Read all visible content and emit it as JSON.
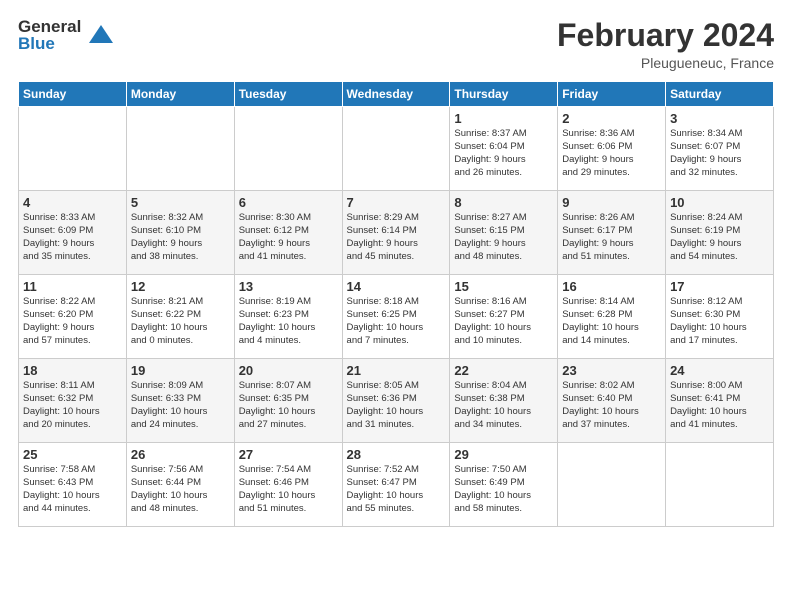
{
  "logo": {
    "general": "General",
    "blue": "Blue"
  },
  "title": "February 2024",
  "location": "Pleugueneuc, France",
  "days_of_week": [
    "Sunday",
    "Monday",
    "Tuesday",
    "Wednesday",
    "Thursday",
    "Friday",
    "Saturday"
  ],
  "weeks": [
    [
      {
        "day": "",
        "info": ""
      },
      {
        "day": "",
        "info": ""
      },
      {
        "day": "",
        "info": ""
      },
      {
        "day": "",
        "info": ""
      },
      {
        "day": "1",
        "info": "Sunrise: 8:37 AM\nSunset: 6:04 PM\nDaylight: 9 hours\nand 26 minutes."
      },
      {
        "day": "2",
        "info": "Sunrise: 8:36 AM\nSunset: 6:06 PM\nDaylight: 9 hours\nand 29 minutes."
      },
      {
        "day": "3",
        "info": "Sunrise: 8:34 AM\nSunset: 6:07 PM\nDaylight: 9 hours\nand 32 minutes."
      }
    ],
    [
      {
        "day": "4",
        "info": "Sunrise: 8:33 AM\nSunset: 6:09 PM\nDaylight: 9 hours\nand 35 minutes."
      },
      {
        "day": "5",
        "info": "Sunrise: 8:32 AM\nSunset: 6:10 PM\nDaylight: 9 hours\nand 38 minutes."
      },
      {
        "day": "6",
        "info": "Sunrise: 8:30 AM\nSunset: 6:12 PM\nDaylight: 9 hours\nand 41 minutes."
      },
      {
        "day": "7",
        "info": "Sunrise: 8:29 AM\nSunset: 6:14 PM\nDaylight: 9 hours\nand 45 minutes."
      },
      {
        "day": "8",
        "info": "Sunrise: 8:27 AM\nSunset: 6:15 PM\nDaylight: 9 hours\nand 48 minutes."
      },
      {
        "day": "9",
        "info": "Sunrise: 8:26 AM\nSunset: 6:17 PM\nDaylight: 9 hours\nand 51 minutes."
      },
      {
        "day": "10",
        "info": "Sunrise: 8:24 AM\nSunset: 6:19 PM\nDaylight: 9 hours\nand 54 minutes."
      }
    ],
    [
      {
        "day": "11",
        "info": "Sunrise: 8:22 AM\nSunset: 6:20 PM\nDaylight: 9 hours\nand 57 minutes."
      },
      {
        "day": "12",
        "info": "Sunrise: 8:21 AM\nSunset: 6:22 PM\nDaylight: 10 hours\nand 0 minutes."
      },
      {
        "day": "13",
        "info": "Sunrise: 8:19 AM\nSunset: 6:23 PM\nDaylight: 10 hours\nand 4 minutes."
      },
      {
        "day": "14",
        "info": "Sunrise: 8:18 AM\nSunset: 6:25 PM\nDaylight: 10 hours\nand 7 minutes."
      },
      {
        "day": "15",
        "info": "Sunrise: 8:16 AM\nSunset: 6:27 PM\nDaylight: 10 hours\nand 10 minutes."
      },
      {
        "day": "16",
        "info": "Sunrise: 8:14 AM\nSunset: 6:28 PM\nDaylight: 10 hours\nand 14 minutes."
      },
      {
        "day": "17",
        "info": "Sunrise: 8:12 AM\nSunset: 6:30 PM\nDaylight: 10 hours\nand 17 minutes."
      }
    ],
    [
      {
        "day": "18",
        "info": "Sunrise: 8:11 AM\nSunset: 6:32 PM\nDaylight: 10 hours\nand 20 minutes."
      },
      {
        "day": "19",
        "info": "Sunrise: 8:09 AM\nSunset: 6:33 PM\nDaylight: 10 hours\nand 24 minutes."
      },
      {
        "day": "20",
        "info": "Sunrise: 8:07 AM\nSunset: 6:35 PM\nDaylight: 10 hours\nand 27 minutes."
      },
      {
        "day": "21",
        "info": "Sunrise: 8:05 AM\nSunset: 6:36 PM\nDaylight: 10 hours\nand 31 minutes."
      },
      {
        "day": "22",
        "info": "Sunrise: 8:04 AM\nSunset: 6:38 PM\nDaylight: 10 hours\nand 34 minutes."
      },
      {
        "day": "23",
        "info": "Sunrise: 8:02 AM\nSunset: 6:40 PM\nDaylight: 10 hours\nand 37 minutes."
      },
      {
        "day": "24",
        "info": "Sunrise: 8:00 AM\nSunset: 6:41 PM\nDaylight: 10 hours\nand 41 minutes."
      }
    ],
    [
      {
        "day": "25",
        "info": "Sunrise: 7:58 AM\nSunset: 6:43 PM\nDaylight: 10 hours\nand 44 minutes."
      },
      {
        "day": "26",
        "info": "Sunrise: 7:56 AM\nSunset: 6:44 PM\nDaylight: 10 hours\nand 48 minutes."
      },
      {
        "day": "27",
        "info": "Sunrise: 7:54 AM\nSunset: 6:46 PM\nDaylight: 10 hours\nand 51 minutes."
      },
      {
        "day": "28",
        "info": "Sunrise: 7:52 AM\nSunset: 6:47 PM\nDaylight: 10 hours\nand 55 minutes."
      },
      {
        "day": "29",
        "info": "Sunrise: 7:50 AM\nSunset: 6:49 PM\nDaylight: 10 hours\nand 58 minutes."
      },
      {
        "day": "",
        "info": ""
      },
      {
        "day": "",
        "info": ""
      }
    ]
  ]
}
